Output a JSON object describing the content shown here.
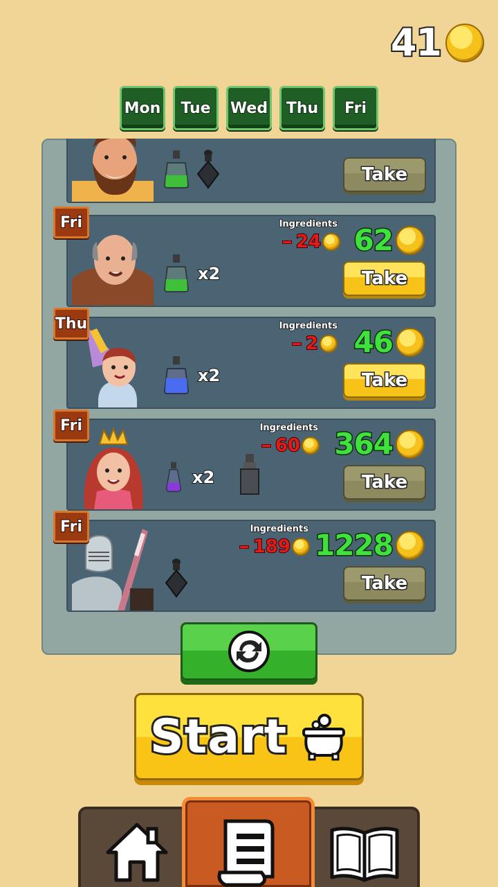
{
  "coins": {
    "value": "41",
    "icon": "gold-coin-icon"
  },
  "days": [
    "Mon",
    "Tue",
    "Wed",
    "Thu",
    "Fri"
  ],
  "orders": [
    {
      "day": "",
      "ingredients_label": "",
      "cost": "",
      "reward": "",
      "take_label": "Take",
      "take_active": false,
      "items": [
        "green-potion-icon",
        "black-potion-icon"
      ],
      "multiplier": "",
      "character": "bearded-man"
    },
    {
      "day": "Fri",
      "ingredients_label": "Ingredients",
      "cost": "24",
      "reward": "62",
      "take_label": "Take",
      "take_active": true,
      "items": [
        "green-potion-icon"
      ],
      "multiplier": "x2",
      "character": "bald-monk"
    },
    {
      "day": "Thu",
      "ingredients_label": "Ingredients",
      "cost": "2",
      "reward": "46",
      "take_label": "Take",
      "take_active": true,
      "items": [
        "blue-potion-icon"
      ],
      "multiplier": "x2",
      "character": "princess-cone-hat"
    },
    {
      "day": "Fri",
      "ingredients_label": "Ingredients",
      "cost": "60",
      "reward": "364",
      "take_label": "Take",
      "take_active": false,
      "items": [
        "purple-potion-icon"
      ],
      "multiplier": "x2",
      "character": "queen",
      "extra_item": "grey-potion-icon"
    },
    {
      "day": "Fri",
      "ingredients_label": "Ingredients",
      "cost": "189",
      "reward": "1228",
      "take_label": "Take",
      "take_active": false,
      "items": [
        "black-potion-icon"
      ],
      "multiplier": "",
      "character": "knight"
    }
  ],
  "refresh": {
    "icon": "refresh-icon"
  },
  "start": {
    "label": "Start",
    "icon": "cauldron-icon"
  },
  "nav": [
    {
      "name": "home",
      "icon": "home-icon"
    },
    {
      "name": "orders",
      "icon": "scroll-list-icon",
      "active": true
    },
    {
      "name": "recipes",
      "icon": "book-icon"
    }
  ],
  "colors": {
    "background": "#f0d596",
    "panel": "#93a7a2",
    "order_card": "#4b6473",
    "reward_green": "#3fe23c",
    "cost_red": "#e21a1a",
    "button_yellow": "#f7c318",
    "button_green": "#35b02b",
    "nav_active": "#c95a22"
  }
}
